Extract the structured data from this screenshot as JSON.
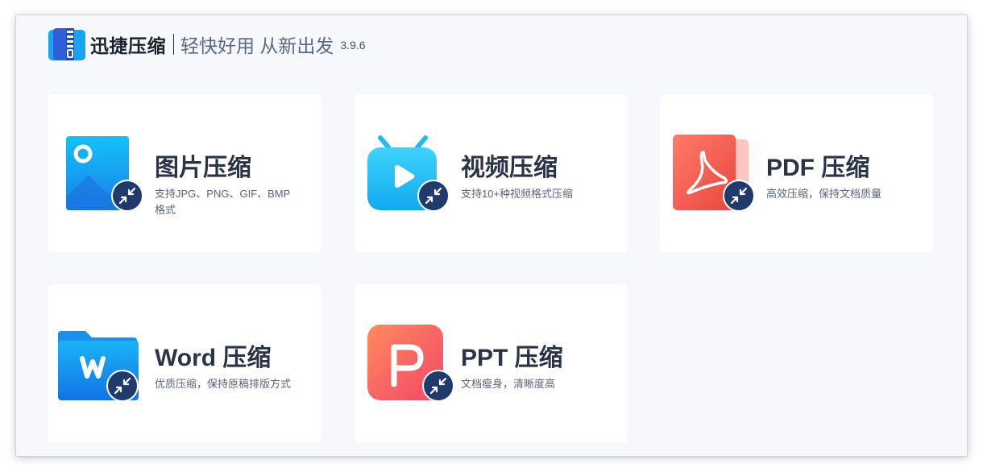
{
  "app": {
    "name": "迅捷压缩",
    "slogan": "轻快好用 从新出发",
    "version": "3.9.6"
  },
  "cards": [
    {
      "title": "图片压缩",
      "desc": "支持JPG、PNG、GIF、BMP格式",
      "icon": "image-icon"
    },
    {
      "title": "视频压缩",
      "desc": "支持10+种视频格式压缩",
      "icon": "tv-video-icon"
    },
    {
      "title": "PDF 压缩",
      "desc": "高效压缩，保持文档质量",
      "icon": "pdf-icon"
    },
    {
      "title": "Word 压缩",
      "desc": "优质压缩，保持原稿排版方式",
      "icon": "word-folder-icon"
    },
    {
      "title": "PPT 压缩",
      "desc": "文档瘦身，清晰度高",
      "icon": "ppt-icon"
    }
  ],
  "colors": {
    "background": "#f6f8fb",
    "title": "#2b3346",
    "badge": "#1f3a6b"
  }
}
